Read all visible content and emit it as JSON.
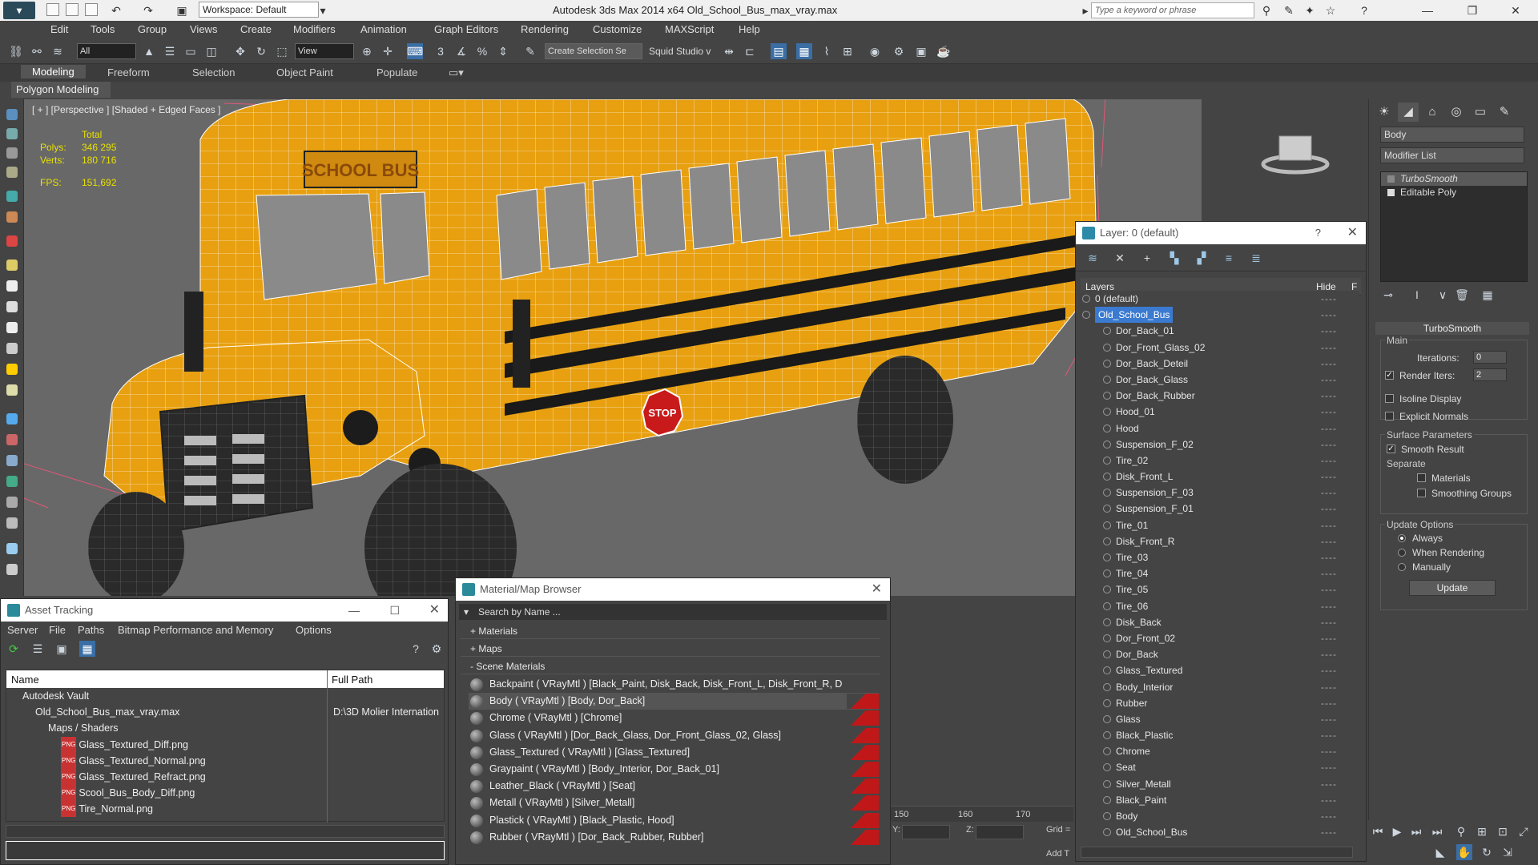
{
  "window": {
    "title": "Autodesk 3ds Max  2014 x64      Old_School_Bus_max_vray.max",
    "workspace": "Workspace: Default",
    "search_placeholder": "Type a keyword or phrase"
  },
  "menu": [
    "Edit",
    "Tools",
    "Group",
    "Views",
    "Create",
    "Modifiers",
    "Animation",
    "Graph Editors",
    "Rendering",
    "Customize",
    "MAXScript",
    "Help"
  ],
  "toolbar": {
    "filter_select": "All",
    "refcoord_select": "View",
    "selection_set": "Create Selection Se",
    "studio_label": "Squid Studio v"
  },
  "ribbon": {
    "tabs": [
      "Modeling",
      "Freeform",
      "Selection",
      "Object Paint",
      "Populate"
    ],
    "active_tab": "Modeling",
    "sub_label": "Polygon Modeling"
  },
  "viewport": {
    "label": "[ + ] [Perspective ] [Shaded + Edged Faces ]",
    "stats": {
      "header": "Total",
      "polys_label": "Polys:",
      "polys": "346 295",
      "verts_label": "Verts:",
      "verts": "180 716",
      "fps_label": "FPS:",
      "fps": "151,692"
    },
    "bus_sign": "SCHOOL BUS",
    "stop_sign": "STOP",
    "accent_color": "#e8a010"
  },
  "layer_dialog": {
    "title": "Layer: 0 (default)",
    "help": "?",
    "col_layers": "Layers",
    "col_hide": "Hide",
    "col_f": "F",
    "layers": [
      {
        "name": "0 (default)",
        "level": 0
      },
      {
        "name": "Old_School_Bus",
        "level": 0,
        "selected": true
      },
      {
        "name": "Dor_Back_01",
        "level": 1
      },
      {
        "name": "Dor_Front_Glass_02",
        "level": 1
      },
      {
        "name": "Dor_Back_Deteil",
        "level": 1
      },
      {
        "name": "Dor_Back_Glass",
        "level": 1
      },
      {
        "name": "Dor_Back_Rubber",
        "level": 1
      },
      {
        "name": "Hood_01",
        "level": 1
      },
      {
        "name": "Hood",
        "level": 1
      },
      {
        "name": "Suspension_F_02",
        "level": 1
      },
      {
        "name": "Tire_02",
        "level": 1
      },
      {
        "name": "Disk_Front_L",
        "level": 1
      },
      {
        "name": "Suspension_F_03",
        "level": 1
      },
      {
        "name": "Suspension_F_01",
        "level": 1
      },
      {
        "name": "Tire_01",
        "level": 1
      },
      {
        "name": "Disk_Front_R",
        "level": 1
      },
      {
        "name": "Tire_03",
        "level": 1
      },
      {
        "name": "Tire_04",
        "level": 1
      },
      {
        "name": "Tire_05",
        "level": 1
      },
      {
        "name": "Tire_06",
        "level": 1
      },
      {
        "name": "Disk_Back",
        "level": 1
      },
      {
        "name": "Dor_Front_02",
        "level": 1
      },
      {
        "name": "Dor_Back",
        "level": 1
      },
      {
        "name": "Glass_Textured",
        "level": 1
      },
      {
        "name": "Body_Interior",
        "level": 1
      },
      {
        "name": "Rubber",
        "level": 1
      },
      {
        "name": "Glass",
        "level": 1
      },
      {
        "name": "Black_Plastic",
        "level": 1
      },
      {
        "name": "Chrome",
        "level": 1
      },
      {
        "name": "Seat",
        "level": 1
      },
      {
        "name": "Silver_Metall",
        "level": 1
      },
      {
        "name": "Black_Paint",
        "level": 1
      },
      {
        "name": "Body",
        "level": 1
      },
      {
        "name": "Old_School_Bus",
        "level": 1
      }
    ]
  },
  "command_panel": {
    "object_name": "Body",
    "modifier_list": "Modifier List",
    "stack": [
      "TurboSmooth",
      "Editable Poly"
    ],
    "rollout_title": "TurboSmooth",
    "main_label": "Main",
    "iterations_label": "Iterations:",
    "iterations": "0",
    "render_iters_label": "Render Iters:",
    "render_iters": "2",
    "isoline_label": "Isoline Display",
    "explicit_normals_label": "Explicit Normals",
    "surface_params_label": "Surface Parameters",
    "smooth_result_label": "Smooth Result",
    "separate_label": "Separate",
    "materials_label": "Materials",
    "smoothing_groups_label": "Smoothing Groups",
    "update_options_label": "Update Options",
    "always_label": "Always",
    "when_rendering_label": "When Rendering",
    "manually_label": "Manually",
    "update_button": "Update"
  },
  "asset_tracking": {
    "title": "Asset Tracking",
    "menu": [
      "Server",
      "File",
      "Paths",
      "Bitmap Performance and Memory",
      "Options"
    ],
    "col_name": "Name",
    "col_path": "Full Path",
    "rows": [
      {
        "name": "Autodesk Vault",
        "path": "",
        "indent": 1
      },
      {
        "name": "Old_School_Bus_max_vray.max",
        "path": "D:\\3D Molier Internation",
        "indent": 2
      },
      {
        "name": "Maps / Shaders",
        "path": "",
        "indent": 3
      },
      {
        "name": "Glass_Textured_Diff.png",
        "path": "",
        "indent": 4
      },
      {
        "name": "Glass_Textured_Normal.png",
        "path": "",
        "indent": 4
      },
      {
        "name": "Glass_Textured_Refract.png",
        "path": "",
        "indent": 4
      },
      {
        "name": "Scool_Bus_Body_Diff.png",
        "path": "",
        "indent": 4
      },
      {
        "name": "Tire_Normal.png",
        "path": "",
        "indent": 4
      }
    ]
  },
  "material_browser": {
    "title": "Material/Map Browser",
    "search_placeholder": "Search by Name ...",
    "sections": [
      "+ Materials",
      "+ Maps",
      "- Scene Materials"
    ],
    "materials": [
      "Backpaint  ( VRayMtl ) [Black_Paint, Disk_Back, Disk_Front_L, Disk_Front_R, Do...",
      "Body  ( VRayMtl ) [Body, Dor_Back]",
      "Chrome  ( VRayMtl ) [Chrome]",
      "Glass  ( VRayMtl ) [Dor_Back_Glass, Dor_Front_Glass_02, Glass]",
      "Glass_Textured  ( VRayMtl ) [Glass_Textured]",
      "Graypaint  ( VRayMtl ) [Body_Interior, Dor_Back_01]",
      "Leather_Black  ( VRayMtl ) [Seat]",
      "Metall  ( VRayMtl ) [Silver_Metall]",
      "Plastick  ( VRayMtl ) [Black_Plastic, Hood]",
      "Rubber  ( VRayMtl ) [Dor_Back_Rubber, Rubber]"
    ]
  },
  "timeline": {
    "ticks": [
      "150",
      "160",
      "170"
    ],
    "y_label": "Y:",
    "z_label": "Z:",
    "grid_label": "Grid =",
    "add_label": "Add T"
  }
}
